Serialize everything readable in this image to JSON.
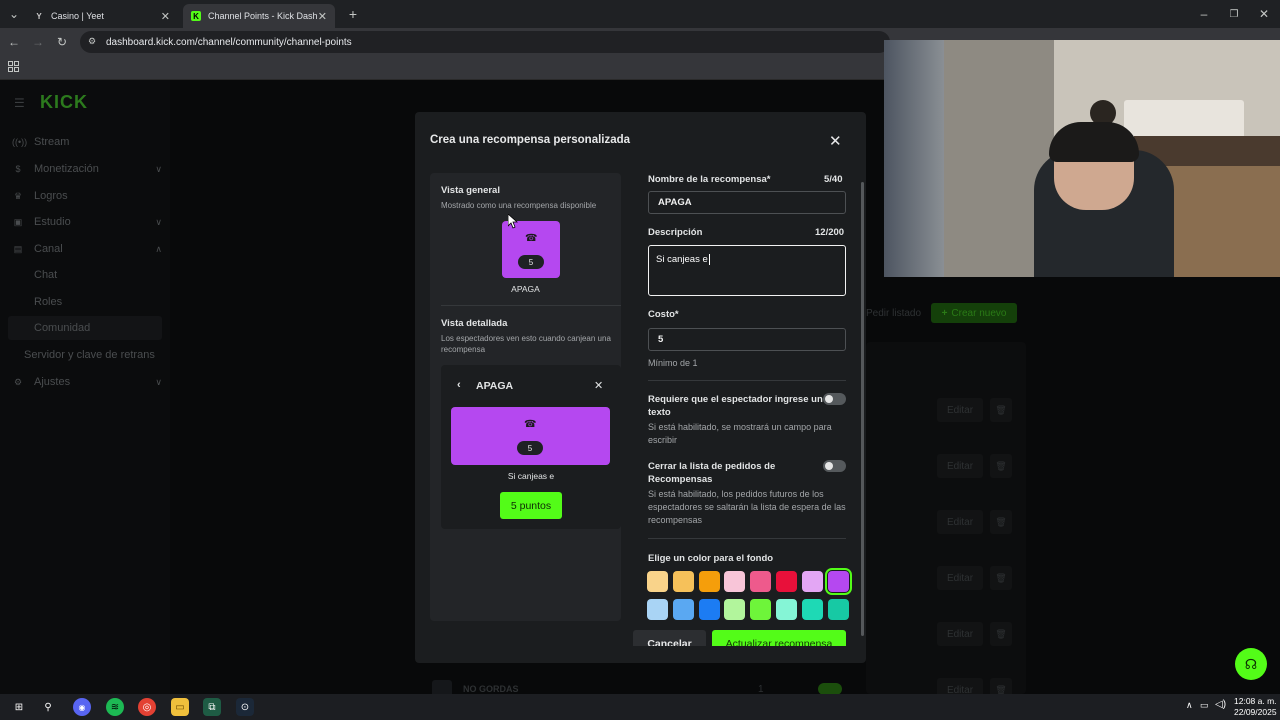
{
  "browser": {
    "tabs": [
      {
        "title": "Casino | Yeet",
        "favicon": "yeet-icon"
      },
      {
        "title": "Channel Points - Kick Dashboa",
        "favicon": "kick-icon"
      }
    ],
    "url": "dashboard.kick.com/channel/community/channel-points"
  },
  "sidebar": {
    "logo": "KICK",
    "items": [
      {
        "label": "Stream"
      },
      {
        "label": "Monetización"
      },
      {
        "label": "Logros"
      },
      {
        "label": "Estudio"
      },
      {
        "label": "Canal"
      },
      {
        "label": "Chat"
      },
      {
        "label": "Roles"
      },
      {
        "label": "Comunidad"
      },
      {
        "label": "Servidor y clave de retrans"
      },
      {
        "label": "Ajustes"
      }
    ]
  },
  "background": {
    "pause_label": "Pedir listado",
    "create_label": "Crear nuevo",
    "edit_label": "Editar",
    "last_row_name": "NO GORDAS",
    "last_row_cost": "1"
  },
  "modal": {
    "title": "Crea una recompensa personalizada",
    "overview_title": "Vista general",
    "overview_sub": "Mostrado como una recompensa disponible",
    "reward_cost": "5",
    "reward_name": "APAGA",
    "detail_title": "Vista detallada",
    "detail_sub": "Los espectadores ven esto cuando canjean una recompensa",
    "detail_desc": "Si canjeas e",
    "detail_points": "5 puntos",
    "name_label": "Nombre de la recompensa*",
    "name_counter": "5/40",
    "name_value": "APAGA",
    "desc_label": "Descripción",
    "desc_counter": "12/200",
    "desc_value": "Si canjeas e",
    "cost_label": "Costo*",
    "cost_value": "5",
    "cost_help": "Mínimo de 1",
    "req_text_label": "Requiere que el espectador ingrese un texto",
    "req_text_help": "Si está habilitado, se mostrará un campo para escribir",
    "close_list_label": "Cerrar la lista de pedidos de Recompensas",
    "close_list_help": "Si está habilitado, los pedidos futuros de los espectadores se saltarán la lista de espera de las recompensas",
    "color_label": "Elige un color para el fondo",
    "colors_row1": [
      "#f9d38a",
      "#f6c15a",
      "#f59e0b",
      "#f8c5d8",
      "#ee5a8c",
      "#e8103a",
      "#e3a6f4",
      "#b548f0"
    ],
    "colors_row2": [
      "#a9d4f5",
      "#5aa8f2",
      "#1c7cf3",
      "#b2f59c",
      "#6ef53a",
      "#85f5d6",
      "#1ed9b5",
      "#17c9a4"
    ],
    "selected_color": "#b548f0",
    "cancel_label": "Cancelar",
    "update_label": "Actualizar recompensa"
  },
  "taskbar": {
    "time": "12:08 a. m.",
    "date": "22/09/2025"
  }
}
